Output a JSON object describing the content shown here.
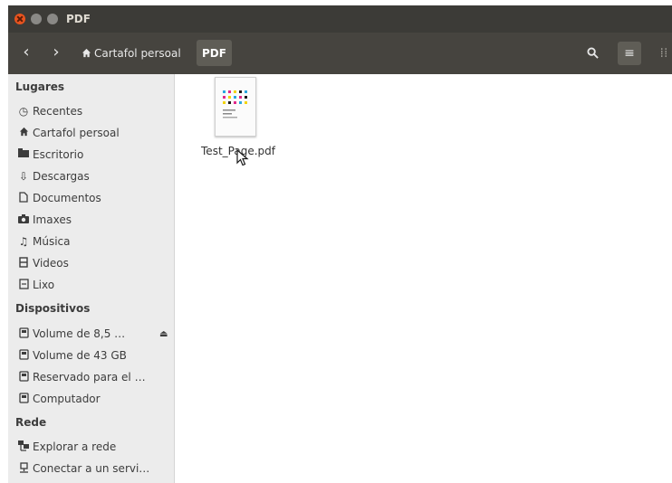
{
  "window": {
    "title": "PDF"
  },
  "toolbar": {
    "back_icon": "‹",
    "forward_icon": "›",
    "breadcrumb_home": "Cartafol persoal",
    "breadcrumb_current": "PDF",
    "search_icon": "magnifier",
    "list_view_icon": "≡",
    "grid_view_icon": "⁞⁞"
  },
  "sidebar": {
    "places_header": "Lugares",
    "places": [
      {
        "label": "Recentes",
        "icon": "clock-icon"
      },
      {
        "label": "Cartafol persoal",
        "icon": "home-icon"
      },
      {
        "label": "Escritorio",
        "icon": "desktop-icon"
      },
      {
        "label": "Descargas",
        "icon": "download-icon"
      },
      {
        "label": "Documentos",
        "icon": "document-icon"
      },
      {
        "label": "Imaxes",
        "icon": "camera-icon"
      },
      {
        "label": "Música",
        "icon": "music-icon"
      },
      {
        "label": "Videos",
        "icon": "video-icon"
      },
      {
        "label": "Lixo",
        "icon": "trash-icon"
      }
    ],
    "devices_header": "Dispositivos",
    "devices": [
      {
        "label": "Volume de 8,5 …",
        "icon": "drive-icon"
      },
      {
        "label": "Volume de 43 GB",
        "icon": "drive-icon"
      },
      {
        "label": "Reservado para el …",
        "icon": "drive-icon"
      },
      {
        "label": "Computador",
        "icon": "drive-icon"
      }
    ],
    "network_header": "Rede",
    "network": [
      {
        "label": "Explorar a rede",
        "icon": "network-icon"
      },
      {
        "label": "Conectar a un servi…",
        "icon": "server-icon"
      }
    ]
  },
  "content": {
    "files": [
      {
        "name": "Test_Page.pdf",
        "icon": "pdf-thumbnail-icon"
      }
    ]
  },
  "colors": {
    "titlebar": "#3c3b37",
    "toolbar": "#46443f",
    "close_button": "#e9541f",
    "sidebar": "#ececec"
  }
}
